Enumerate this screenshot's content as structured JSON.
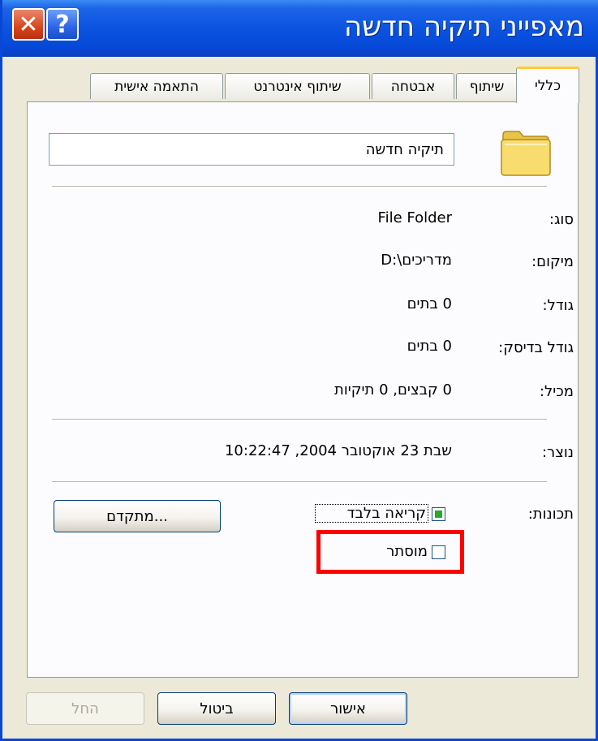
{
  "window": {
    "title": "מאפייני תיקיה חדשה"
  },
  "titlebar": {
    "close_glyph": "✕",
    "help_glyph": "?"
  },
  "tabs": [
    "כללי",
    "שיתוף",
    "אבטחה",
    "שיתוף אינטרנט",
    "התאמה אישית"
  ],
  "general": {
    "folder_icon": "folder-icon",
    "name": "תיקיה חדשה",
    "rows": [
      {
        "label": "סוג:",
        "value": "File Folder"
      },
      {
        "label": "מיקום:",
        "value": "D:\\מדריכים"
      },
      {
        "label": "גודל:",
        "value": "0 בתים"
      },
      {
        "label": "גודל בדיסק:",
        "value": "0 בתים"
      },
      {
        "label": "מכיל:",
        "value": "0 קבצים, 0 תיקיות"
      }
    ],
    "created": {
      "label": "נוצר:",
      "value": "שבת 23 אוקטובר 2004, 10:22:47"
    },
    "attributes": {
      "label": "תכונות:",
      "read_only": {
        "label": "קריאה בלבד",
        "state": "indeterminate"
      },
      "hidden": {
        "label": "מוסתר",
        "checked": false
      },
      "advanced_button": "מתקדם..."
    }
  },
  "buttons": {
    "ok": "אישור",
    "cancel": "ביטול",
    "apply": "החל"
  },
  "colors": {
    "highlight": "#ff0000",
    "titlebar": "#0a52e0",
    "active_tab": "#ffc73c"
  }
}
